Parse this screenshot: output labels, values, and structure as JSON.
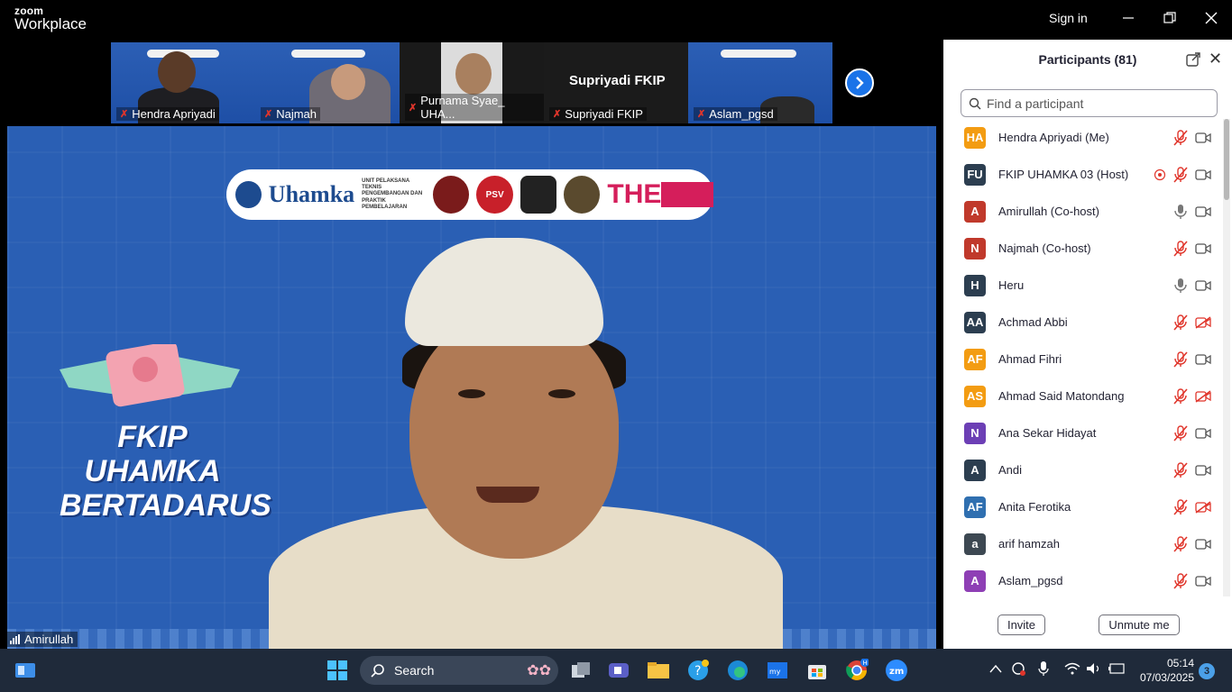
{
  "app": {
    "logo_line1": "zoom",
    "logo_line2": "Workplace",
    "sign_in": "Sign in"
  },
  "window_controls": [
    "minimize",
    "restore",
    "close"
  ],
  "thumbnails": [
    {
      "name": "Hendra Apriyadi",
      "muted": true
    },
    {
      "name": "Najmah",
      "muted": true
    },
    {
      "name": "Purnama Syae_ UHA...",
      "muted": true
    },
    {
      "name": "Supriyadi FKIP",
      "muted": true,
      "video_label": "Supriyadi FKIP"
    },
    {
      "name": "Aslam_pgsd",
      "muted": true
    }
  ],
  "main_video": {
    "speaker": "Amirullah",
    "banner_brand": "Uhamka",
    "banner_unit": "UNIT PELAKSANA TEKNIS PENGEMBANGAN DAN PRAKTIK PEMBELAJARAN",
    "banner_the": "THE",
    "banner_psv": "PSV",
    "event_title_line1": "FKIP UHAMKA",
    "event_title_line2": "BERTADARUS"
  },
  "participants_panel": {
    "title": "Participants (81)",
    "search_placeholder": "Find a participant",
    "participants": [
      {
        "initials": "HA",
        "name": "Hendra Apriyadi (Me)",
        "color": "#f39c12",
        "mic": "muted",
        "video": "on",
        "rec": false
      },
      {
        "initials": "FU",
        "name": "FKIP UHAMKA 03 (Host)",
        "color": "#2c3e50",
        "mic": "muted",
        "video": "on",
        "rec": true
      },
      {
        "initials": "A",
        "name": "Amirullah (Co-host)",
        "color": "#c0392b",
        "mic": "on",
        "video": "on",
        "rec": false
      },
      {
        "initials": "N",
        "name": "Najmah (Co-host)",
        "color": "#c0392b",
        "mic": "muted",
        "video": "on",
        "rec": false
      },
      {
        "initials": "H",
        "name": "Heru",
        "color": "#2c3e50",
        "mic": "on",
        "video": "on",
        "rec": false
      },
      {
        "initials": "AA",
        "name": "Achmad Abbi",
        "color": "#2c3e50",
        "mic": "muted",
        "video": "off",
        "rec": false
      },
      {
        "initials": "AF",
        "name": "Ahmad Fihri",
        "color": "#f39c12",
        "mic": "muted",
        "video": "on",
        "rec": false
      },
      {
        "initials": "AS",
        "name": "Ahmad Said Matondang",
        "color": "#f39c12",
        "mic": "muted",
        "video": "off",
        "rec": false
      },
      {
        "initials": "N",
        "name": "Ana Sekar Hidayat",
        "color": "#6c3fb5",
        "mic": "muted",
        "video": "on",
        "rec": false
      },
      {
        "initials": "A",
        "name": "Andi",
        "color": "#2c3e50",
        "mic": "muted",
        "video": "on",
        "rec": false
      },
      {
        "initials": "AF",
        "name": "Anita Ferotika",
        "color": "#2f6fb0",
        "mic": "muted",
        "video": "off",
        "rec": false
      },
      {
        "initials": "a",
        "name": "arif hamzah",
        "color": "#3d4852",
        "mic": "muted",
        "video": "on",
        "rec": false
      },
      {
        "initials": "A",
        "name": "Aslam_pgsd",
        "color": "#8e3fb5",
        "mic": "muted",
        "video": "on",
        "rec": false
      }
    ],
    "invite_label": "Invite",
    "unmute_label": "Unmute me"
  },
  "taskbar": {
    "search_label": "Search",
    "time": "05:14",
    "date": "07/03/2025",
    "notification_count": "3",
    "chrome_badge": "H"
  }
}
